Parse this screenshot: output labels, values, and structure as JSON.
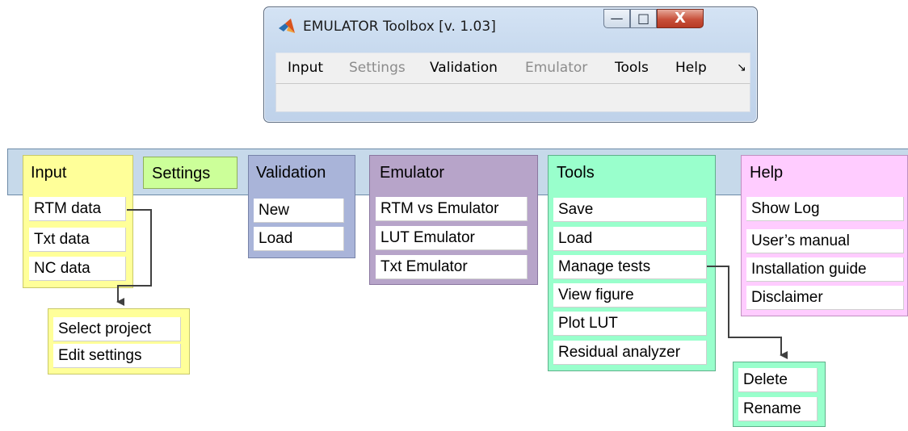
{
  "window": {
    "title": "EMULATOR Toolbox [v. 1.03]",
    "buttons": {
      "minimize": "—",
      "maximize": "□",
      "close": "X"
    },
    "menu": [
      {
        "label": "Input",
        "enabled": true
      },
      {
        "label": "Settings",
        "enabled": false
      },
      {
        "label": "Validation",
        "enabled": true
      },
      {
        "label": "Emulator",
        "enabled": false
      },
      {
        "label": "Tools",
        "enabled": true
      },
      {
        "label": "Help",
        "enabled": true
      }
    ],
    "menu_overflow": "↘"
  },
  "diagram": {
    "input": {
      "title": "Input",
      "items": [
        "RTM data",
        "Txt data",
        "NC data"
      ]
    },
    "input_sub": {
      "items": [
        "Select project",
        "Edit settings"
      ]
    },
    "settings": {
      "title": "Settings"
    },
    "validation": {
      "title": "Validation",
      "items": [
        "New",
        "Load"
      ]
    },
    "emulator": {
      "title": "Emulator",
      "items": [
        "RTM vs Emulator",
        "LUT Emulator",
        "Txt Emulator"
      ]
    },
    "tools": {
      "title": "Tools",
      "items": [
        "Save",
        "Load",
        "Manage tests",
        "View figure",
        "Plot LUT",
        "Residual analyzer"
      ]
    },
    "tools_sub": {
      "items": [
        "Delete",
        "Rename"
      ]
    },
    "help": {
      "title": "Help",
      "items": [
        "Show Log",
        "User’s manual",
        "Installation guide",
        "Disclaimer"
      ]
    }
  },
  "colors": {
    "bar": "#c6d9ea",
    "input": "#ffff99",
    "settings": "#ccff99",
    "validation": "#a9b4d9",
    "emulator": "#b7a4c9",
    "tools": "#99ffcc",
    "help": "#ffccff",
    "disabled_text": "#8c8c8c"
  }
}
